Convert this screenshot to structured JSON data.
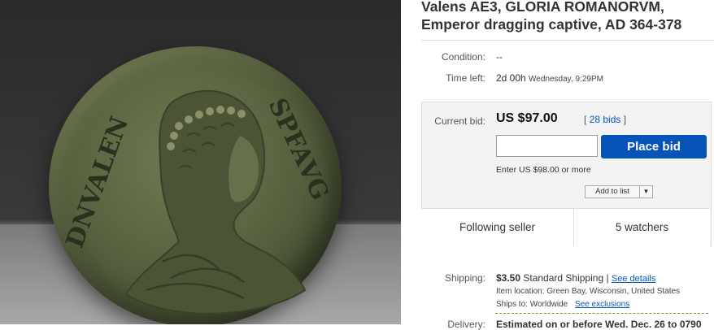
{
  "photo": {
    "coin_legend_left": "DNVALEN",
    "coin_legend_right": "SPFAVG"
  },
  "listing": {
    "title": "Valens AE3, GLORIA ROMANORVM, Emperor dragging captive, AD 364-378"
  },
  "condition": {
    "label": "Condition:",
    "value": "--"
  },
  "time_left": {
    "label": "Time left:",
    "value": "2d 00h",
    "detail": "Wednesday, 9:29PM"
  },
  "bid": {
    "label": "Current bid:",
    "amount": "US $97.00",
    "bids_prefix": "[",
    "bids_link": "28 bids",
    "bids_suffix": "]",
    "input_placeholder": "",
    "place_bid_label": "Place bid",
    "enter_hint": "Enter US $98.00 or more",
    "add_to_list_label": "Add to list"
  },
  "following": {
    "seller_label": "Following seller",
    "watchers_label": "5 watchers"
  },
  "shipping": {
    "label": "Shipping:",
    "price": "$3.50",
    "service": "Standard Shipping |",
    "details_link": "See details",
    "item_location_label": "Item location:",
    "item_location": "Green Bay, Wisconsin, United States",
    "ships_to_label": "Ships to:",
    "ships_to": "Worldwide",
    "exclusions_link": "See exclusions"
  },
  "delivery": {
    "label": "Delivery:",
    "value": "Estimated on or before Wed. Dec. 26 to 0790"
  },
  "icons": {
    "dropdown": "chevron-down-icon"
  }
}
